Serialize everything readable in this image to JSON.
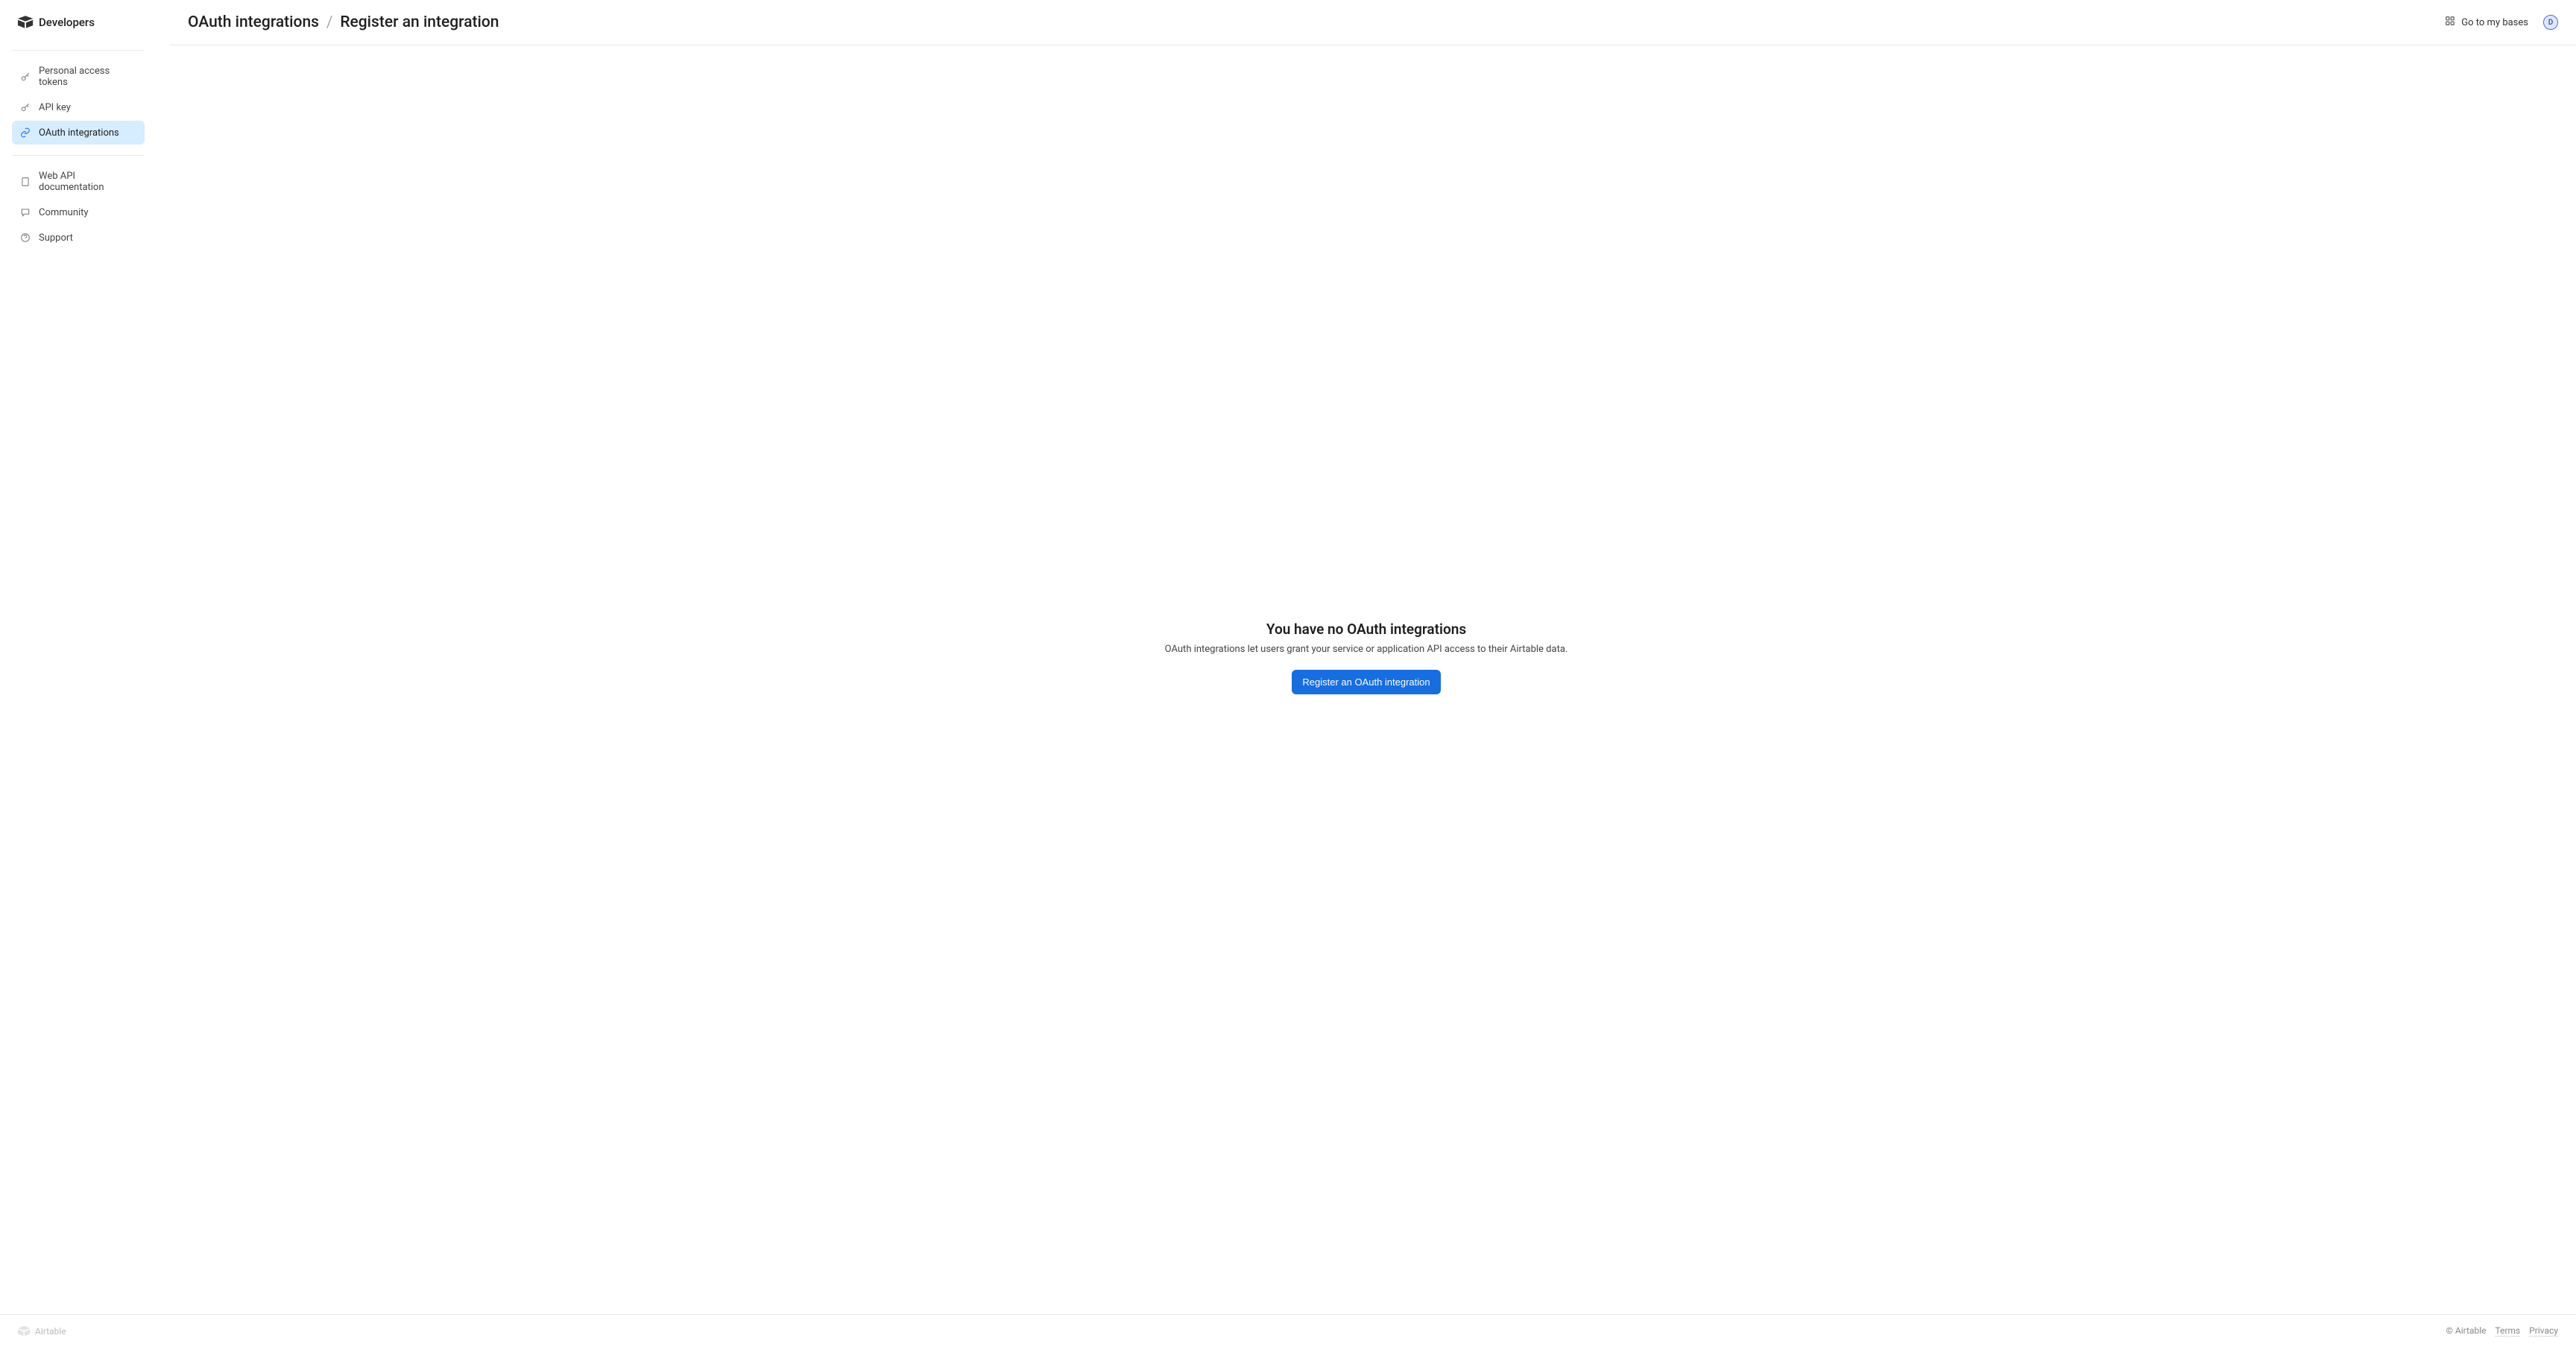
{
  "sidebar": {
    "logo_text": "Developers",
    "nav_primary": [
      {
        "label": "Personal access tokens",
        "icon": "key"
      },
      {
        "label": "API key",
        "icon": "key"
      },
      {
        "label": "OAuth integrations",
        "icon": "link",
        "active": true
      }
    ],
    "nav_secondary": [
      {
        "label": "Web API documentation",
        "icon": "book"
      },
      {
        "label": "Community",
        "icon": "comment"
      },
      {
        "label": "Support",
        "icon": "help"
      }
    ]
  },
  "header": {
    "breadcrumb_parent": "OAuth integrations",
    "breadcrumb_separator": "/",
    "breadcrumb_current": "Register an integration",
    "go_to_bases_label": "Go to my bases",
    "avatar_initial": "D"
  },
  "empty_state": {
    "title": "You have no OAuth integrations",
    "description": "OAuth integrations let users grant your service or application API access to their Airtable data.",
    "button_label": "Register an OAuth integration"
  },
  "footer": {
    "logo_text": "Airtable",
    "copyright": "© Airtable",
    "terms": "Terms",
    "privacy": "Privacy"
  }
}
